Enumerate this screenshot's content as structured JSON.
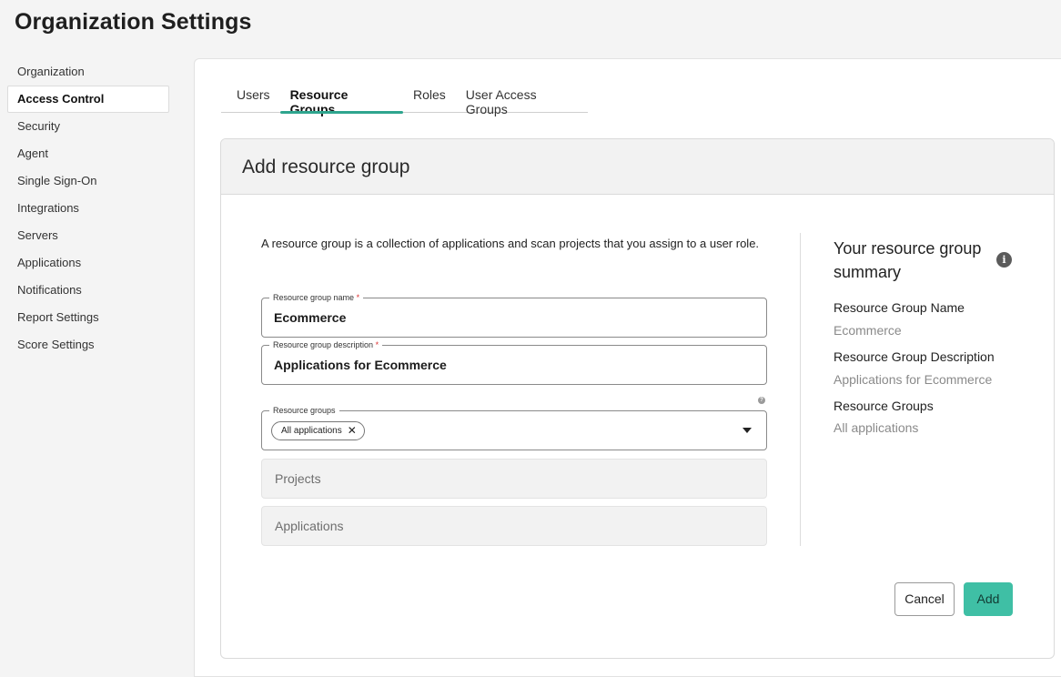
{
  "page": {
    "title": "Organization Settings"
  },
  "sidebar": {
    "items": [
      {
        "label": "Organization"
      },
      {
        "label": "Access Control"
      },
      {
        "label": "Security"
      },
      {
        "label": "Agent"
      },
      {
        "label": "Single Sign-On"
      },
      {
        "label": "Integrations"
      },
      {
        "label": "Servers"
      },
      {
        "label": "Applications"
      },
      {
        "label": "Notifications"
      },
      {
        "label": "Report Settings"
      },
      {
        "label": "Score Settings"
      }
    ],
    "active_index": 1
  },
  "tabs": [
    {
      "label": "Users"
    },
    {
      "label": "Resource Groups"
    },
    {
      "label": "Roles"
    },
    {
      "label": "User Access Groups"
    }
  ],
  "active_tab": 1,
  "card": {
    "title": "Add resource group",
    "intro": "A resource group is a collection of applications and scan projects that you assign to a user role."
  },
  "form": {
    "name": {
      "label": "Resource group name",
      "required_mark": "*",
      "value": "Ecommerce"
    },
    "description": {
      "label": "Resource group description",
      "required_mark": "*",
      "value": "Applications for Ecommerce"
    },
    "resource_groups": {
      "label": "Resource groups",
      "chip": "All applications",
      "chip_remove": "✕",
      "help": "?"
    },
    "projects": {
      "placeholder": "Projects"
    },
    "applications": {
      "placeholder": "Applications"
    }
  },
  "summary": {
    "title": "Your resource group summary",
    "info_glyph": "i",
    "name_label": "Resource Group Name",
    "name_value": "Ecommerce",
    "description_label": "Resource Group Description",
    "description_value": "Applications for Ecommerce",
    "groups_label": "Resource Groups",
    "groups_value": "All applications"
  },
  "actions": {
    "cancel": "Cancel",
    "add": "Add"
  },
  "colors": {
    "accent": "#2ea58e",
    "add_button": "#3fbfa5",
    "required": "#dd3333"
  },
  "icons": [
    "chevron-down-icon",
    "help-icon",
    "info-icon",
    "close-icon"
  ]
}
